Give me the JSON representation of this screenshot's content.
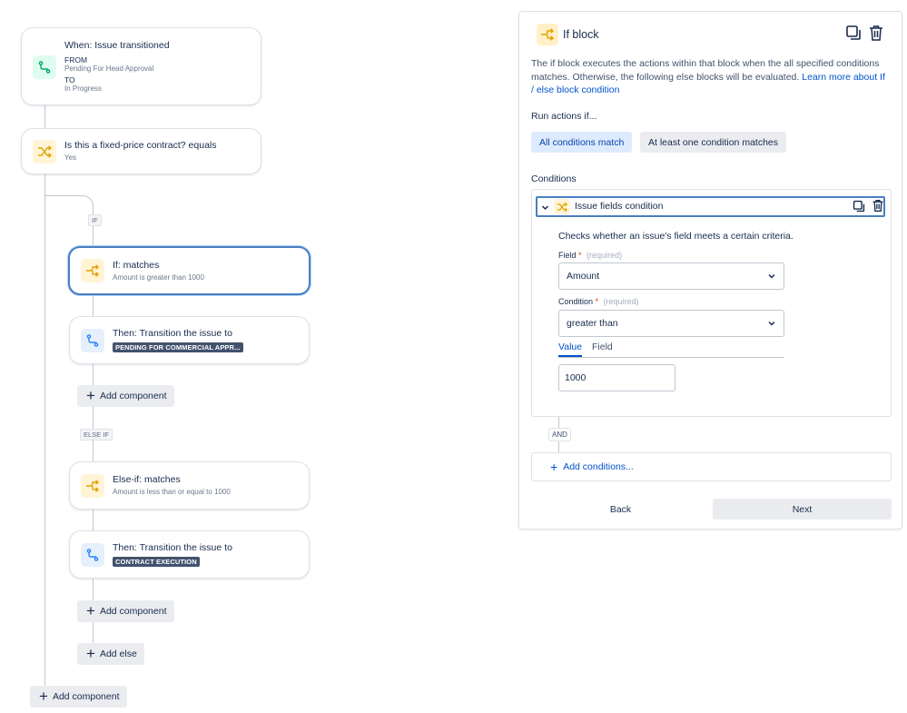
{
  "tree": {
    "trigger": {
      "title": "When: Issue transitioned",
      "from_label": "FROM",
      "from_value": "Pending For Head Approval",
      "to_label": "TO",
      "to_value": "In Progress"
    },
    "condition": {
      "title": "Is this a fixed-price contract? equals",
      "value": "Yes"
    },
    "if_tag": "IF",
    "if_block": {
      "title": "If: matches",
      "subtitle": "Amount is greater than 1000"
    },
    "then_1": {
      "title": "Then: Transition the issue to",
      "status": "PENDING FOR COMMERCIAL APPR..."
    },
    "add_component_1": "Add component",
    "else_if_tag": "ELSE IF",
    "else_if_block": {
      "title": "Else-if: matches",
      "subtitle": "Amount is less than or equal to 1000"
    },
    "then_2": {
      "title": "Then: Transition the issue to",
      "status": "CONTRACT EXECUTION"
    },
    "add_component_2": "Add component",
    "add_else": "Add else",
    "add_component_root": "Add component"
  },
  "panel": {
    "title": "If block",
    "description": "The if block executes the actions within that block when the all specified conditions matches. Otherwise, the following else blocks will be evaluated.",
    "learn_more": "Learn more about If / else block condition",
    "run_label": "Run actions if...",
    "seg_all": "All conditions match",
    "seg_any": "At least one condition matches",
    "conditions_label": "Conditions",
    "condition_item": {
      "title": "Issue fields condition",
      "description": "Checks whether an issue's field meets a certain criteria.",
      "field_label": "Field",
      "field_required": "*",
      "field_hint": "(required)",
      "field_value": "Amount",
      "condition_label": "Condition",
      "condition_required": "*",
      "condition_hint": "(required)",
      "condition_value": "greater than",
      "tab_value": "Value",
      "tab_field": "Field",
      "value": "1000"
    },
    "and_tag": "AND",
    "add_conditions": "Add conditions...",
    "back": "Back",
    "next": "Next"
  },
  "colors": {
    "accent": "#0052cc",
    "selected_border": "#4a7fc1",
    "trigger_icon": "#00a86b",
    "condition_icon": "#e2a100",
    "action_icon": "#2684ff"
  }
}
